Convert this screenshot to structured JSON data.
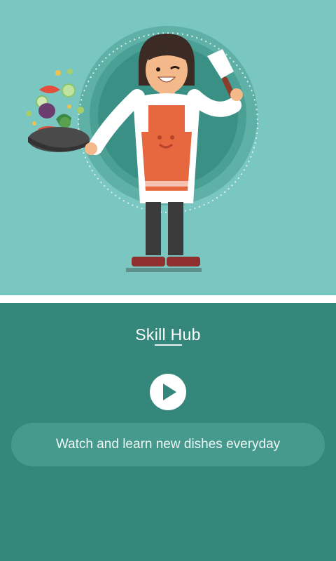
{
  "app": {
    "title": "Skill Hub",
    "tagline": "Watch and learn new dishes everyday"
  },
  "icons": {
    "play": "play-icon",
    "illustration": "chef-woman-cooking-illustration"
  },
  "colors": {
    "hero_bg": "#7ac6c0",
    "panel_bg": "#34877a",
    "pill_bg": "#459a8d",
    "apron": "#e7673f",
    "accent_white": "#ffffff"
  }
}
